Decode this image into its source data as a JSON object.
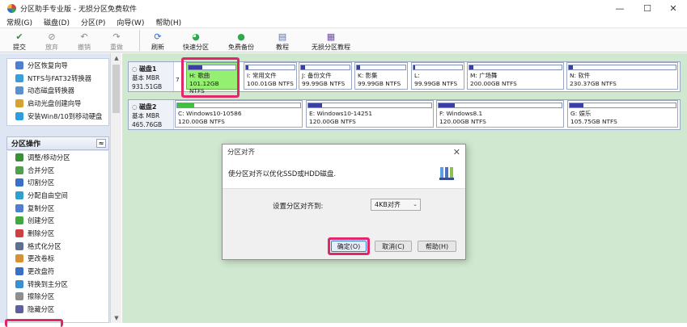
{
  "window": {
    "title": "分区助手专业版 - 无损分区免费软件",
    "controls": {
      "minimize": "—",
      "maximize": "☐",
      "close": "✕"
    }
  },
  "menu": [
    "常规(G)",
    "磁盘(D)",
    "分区(P)",
    "向导(W)",
    "帮助(H)"
  ],
  "toolbar": {
    "submit": "提交",
    "discard": "放弃",
    "undo": "撤销",
    "redo": "重做",
    "refresh": "刷新",
    "quick_partition": "快速分区",
    "free_backup": "免费备份",
    "tutorial": "教程",
    "lossless_tutorial": "无损分区教程"
  },
  "wizards": [
    "分区恢复向导",
    "NTFS与FAT32转换器",
    "动态磁盘转换器",
    "启动光盘创建向导",
    "安装Win8/10到移动硬盘"
  ],
  "partition_ops": {
    "header": "分区操作",
    "collapse_glyph": "≈",
    "items": [
      "调整/移动分区",
      "合并分区",
      "切割分区",
      "分配自由空间",
      "复制分区",
      "创建分区",
      "删除分区",
      "格式化分区",
      "更改卷标",
      "更改盘符",
      "转换到主分区",
      "擦除分区",
      "隐藏分区"
    ]
  },
  "disk1": {
    "name": "磁盘1",
    "type": "基本 MBR",
    "size": "931.51GB",
    "hidden_part_char": "7",
    "partitions": [
      {
        "name": "H: 歌曲",
        "size": "101.12GB NTFS",
        "fill": 0.3,
        "selected": true
      },
      {
        "name": "I: 常用文件",
        "size": "100.01GB NTFS",
        "fill": 0.05
      },
      {
        "name": "J: 备份文件",
        "size": "99.99GB NTFS",
        "fill": 0.08
      },
      {
        "name": "K: 影集",
        "size": "99.99GB NTFS",
        "fill": 0.06
      },
      {
        "name": "L:",
        "size": "99.99GB NTFS",
        "fill": 0.04
      },
      {
        "name": "M: 广场舞",
        "size": "200.00GB NTFS",
        "fill": 0.04
      },
      {
        "name": "N: 软件",
        "size": "230.37GB NTFS",
        "fill": 0.04
      }
    ]
  },
  "disk2": {
    "name": "磁盘2",
    "type": "基本 MBR",
    "size": "465.76GB",
    "partitions": [
      {
        "name": "C: Windows10-10586",
        "size": "120.00GB NTFS",
        "fill": 0.14,
        "green": true
      },
      {
        "name": "E: Windows10-14251",
        "size": "120.00GB NTFS",
        "fill": 0.11
      },
      {
        "name": "F: Windows8.1",
        "size": "120.00GB NTFS",
        "fill": 0.13
      },
      {
        "name": "G: 娱乐",
        "size": "105.75GB NTFS",
        "fill": 0.13
      }
    ]
  },
  "dialog": {
    "title": "分区对齐",
    "description": "使分区对齐以优化SSD或HDD磁盘.",
    "label": "设置分区对齐到:",
    "selected_value": "4KB对齐",
    "ok": "确定(O)",
    "cancel": "取消(C)",
    "help": "帮助(H)"
  },
  "colors": {
    "highlight": "#e0276a",
    "sidebar_bg": "#dfe6f3",
    "main_bg": "#cfe8cf",
    "used_fill": "#3a3fa8",
    "selected_partition": "#94f070"
  }
}
